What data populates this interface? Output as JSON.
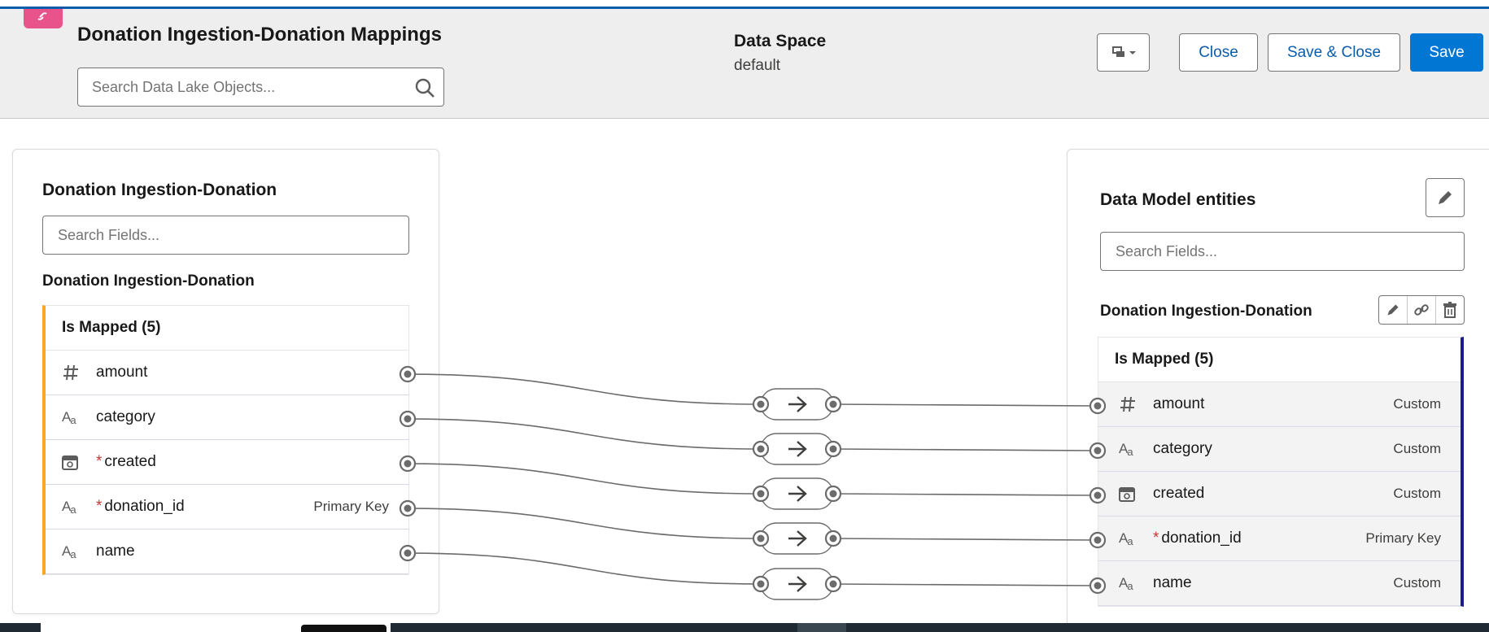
{
  "header": {
    "title": "Donation Ingestion-Donation Mappings",
    "search_placeholder": "Search Data Lake Objects...",
    "data_space_label": "Data Space",
    "data_space_value": "default",
    "buttons": {
      "close": "Close",
      "save_close": "Save & Close",
      "save": "Save"
    }
  },
  "left_panel": {
    "title": "Donation Ingestion-Donation",
    "search_placeholder": "Search Fields...",
    "object_name": "Donation Ingestion-Donation",
    "group_label": "Is Mapped (5)",
    "fields": [
      {
        "name": "amount",
        "type_icon": "number-icon",
        "required": "",
        "tag": ""
      },
      {
        "name": "category",
        "type_icon": "text-icon",
        "required": "",
        "tag": ""
      },
      {
        "name": "created",
        "type_icon": "datetime-icon",
        "required": "*",
        "tag": ""
      },
      {
        "name": "donation_id",
        "type_icon": "text-icon",
        "required": "*",
        "tag": "Primary Key"
      },
      {
        "name": "name",
        "type_icon": "text-icon",
        "required": "",
        "tag": ""
      }
    ]
  },
  "right_panel": {
    "title": "Data Model entities",
    "search_placeholder": "Search Fields...",
    "object_name": "Donation Ingestion-Donation",
    "group_label": "Is Mapped (5)",
    "fields": [
      {
        "name": "amount",
        "type_icon": "number-icon",
        "required": "",
        "tag": "Custom"
      },
      {
        "name": "category",
        "type_icon": "text-icon",
        "required": "",
        "tag": "Custom"
      },
      {
        "name": "created",
        "type_icon": "datetime-icon",
        "required": "",
        "tag": "Custom"
      },
      {
        "name": "donation_id",
        "type_icon": "text-icon",
        "required": "*",
        "tag": "Primary Key"
      },
      {
        "name": "name",
        "type_icon": "text-icon",
        "required": "",
        "tag": "Custom"
      }
    ]
  },
  "mappings": {
    "count": 5,
    "arrow_icon": "arrow-right-icon"
  },
  "colors": {
    "brand": "#0176d3",
    "mapped_left": "#f9a825",
    "mapped_right": "#1b1b8a",
    "connector": "#6b6b6b"
  }
}
